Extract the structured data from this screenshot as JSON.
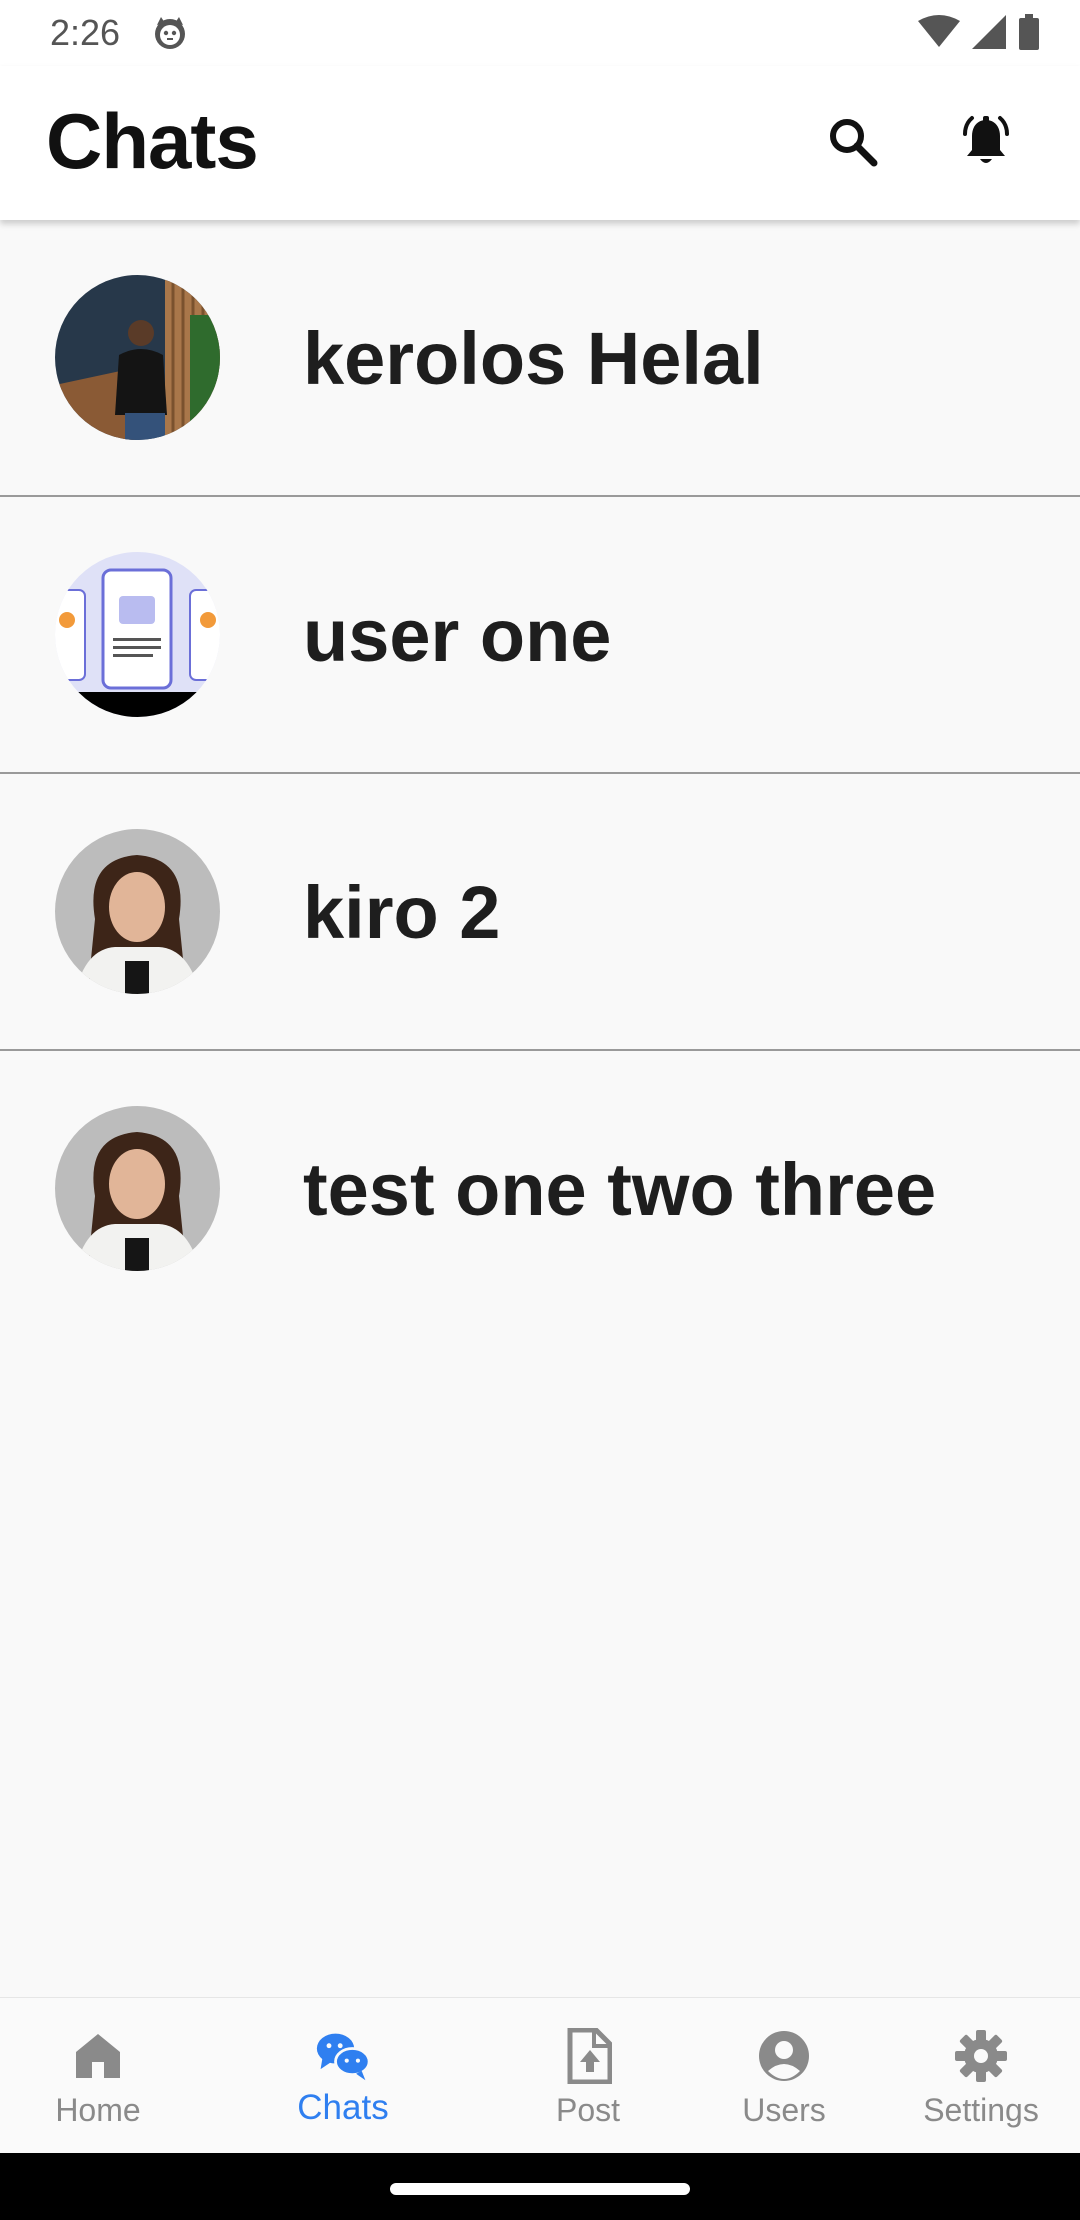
{
  "status_bar": {
    "time": "2:26",
    "icons": [
      "cat-notification-icon",
      "wifi-icon",
      "signal-icon",
      "battery-icon"
    ]
  },
  "app_bar": {
    "title": "Chats",
    "actions": [
      "search-icon",
      "bell-ring-icon"
    ]
  },
  "chats": [
    {
      "name": "kerolos Helal",
      "avatar": "man-portrait-photo"
    },
    {
      "name": "user one",
      "avatar": "app-screens-illustration"
    },
    {
      "name": "kiro 2",
      "avatar": "woman-portrait-photo"
    },
    {
      "name": "test one two three",
      "avatar": "woman-portrait-photo"
    }
  ],
  "bottom_nav": {
    "active": "Chats",
    "items": [
      {
        "label": "Home",
        "icon": "home-icon"
      },
      {
        "label": "Chats",
        "icon": "chat-bubbles-icon"
      },
      {
        "label": "Post",
        "icon": "file-upload-icon"
      },
      {
        "label": "Users",
        "icon": "account-circle-icon"
      },
      {
        "label": "Settings",
        "icon": "gear-icon"
      }
    ]
  },
  "colors": {
    "active_nav": "#2f7ff0",
    "inactive_nav": "#8a8a8a",
    "background": "#f9f9f9",
    "app_bar": "#ffffff",
    "divider": "#9a9a9a"
  }
}
